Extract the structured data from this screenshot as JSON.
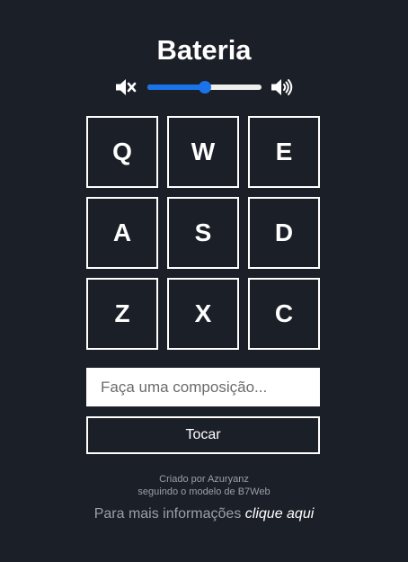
{
  "app": {
    "title": "Bateria"
  },
  "volume": {
    "value": 0.5,
    "mute_icon": "volume-mute-icon",
    "loud_icon": "volume-up-icon"
  },
  "keys": [
    "Q",
    "W",
    "E",
    "A",
    "S",
    "D",
    "Z",
    "X",
    "C"
  ],
  "composition": {
    "placeholder": "Faça uma composição...",
    "value": ""
  },
  "play_button": {
    "label": "Tocar"
  },
  "footer": {
    "credit_line1": "Criado por Azuryanz",
    "credit_line2": "seguindo o modelo de B7Web",
    "info_text": "Para mais informações",
    "info_link": "clique aqui"
  },
  "colors": {
    "background": "#1b1f27",
    "accent": "#1a73e8",
    "text": "#ffffff",
    "muted_text": "#9aa0a6"
  }
}
